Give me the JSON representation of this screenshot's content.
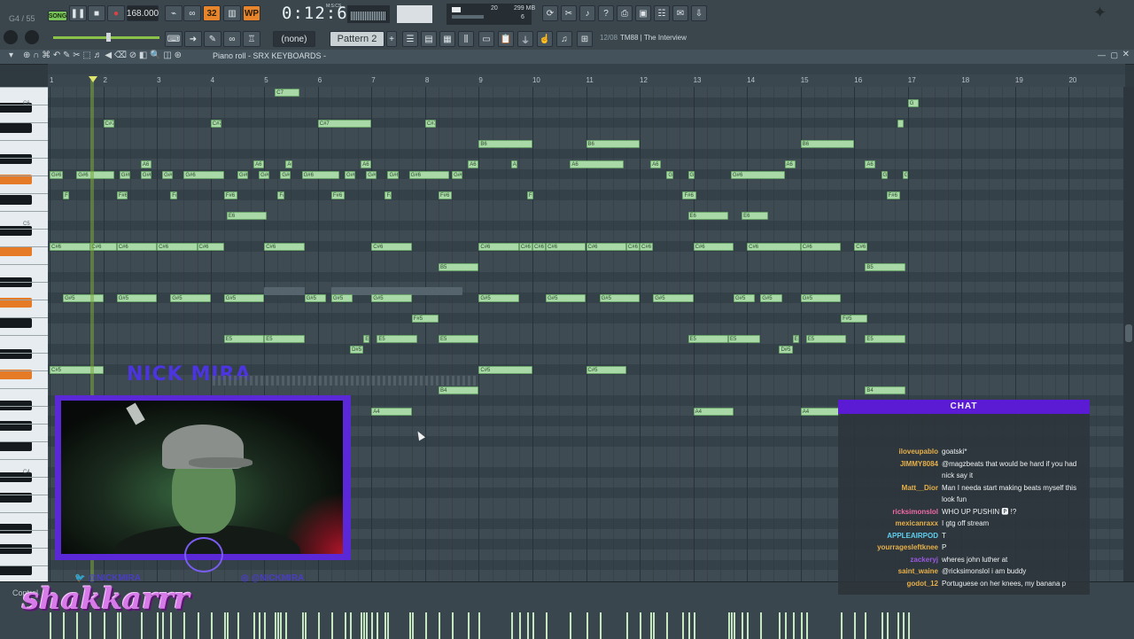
{
  "toolbar": {
    "song_label": "SONG",
    "tempo": "168.000",
    "time": "0:12:63",
    "time_unit": "M:S:CS",
    "memory": "299 MB",
    "cpu_left": "20",
    "cpu_right": "6",
    "snap_none": "(none)",
    "pattern": "Pattern 2",
    "hint_counter": "12/08",
    "hint_text": "TM88 | The Interview",
    "pos_readout": "G4 / 55",
    "btn_32": "32",
    "btn_wp": "WP"
  },
  "piano_roll": {
    "title": "Piano roll - SRX KEYBOARDS -",
    "bars": [
      "1",
      "2",
      "3",
      "4",
      "5",
      "6",
      "7",
      "8",
      "9",
      "10",
      "11",
      "12",
      "13",
      "14",
      "15",
      "16",
      "17",
      "18",
      "19",
      "20"
    ],
    "key_labels": [
      "C6",
      "C5",
      "C4"
    ],
    "notes": [
      {
        "label": "C7",
        "bar": 5.2,
        "len": 0.45,
        "row": 0
      },
      {
        "label": "G",
        "bar": 17.0,
        "len": 0.2,
        "row": 1
      },
      {
        "label": "C#7",
        "bar": 2.0,
        "len": 0.2,
        "row": 3
      },
      {
        "label": "C#7",
        "bar": 4.0,
        "len": 0.2,
        "row": 3
      },
      {
        "label": "C#7",
        "bar": 6.0,
        "len": 1.0,
        "row": 3
      },
      {
        "label": "C#7",
        "bar": 8.0,
        "len": 0.2,
        "row": 3
      },
      {
        "label": "",
        "bar": 16.8,
        "len": 0.12,
        "row": 3
      },
      {
        "label": "B6",
        "bar": 9.0,
        "len": 1.0,
        "row": 5
      },
      {
        "label": "B6",
        "bar": 11.0,
        "len": 1.0,
        "row": 5
      },
      {
        "label": "B6",
        "bar": 15.0,
        "len": 1.0,
        "row": 5
      },
      {
        "label": "A6",
        "bar": 2.7,
        "len": 0.2,
        "row": 7
      },
      {
        "label": "A6",
        "bar": 4.8,
        "len": 0.2,
        "row": 7
      },
      {
        "label": "A6",
        "bar": 5.4,
        "len": 0.12,
        "row": 7
      },
      {
        "label": "A6",
        "bar": 6.8,
        "len": 0.2,
        "row": 7
      },
      {
        "label": "A6",
        "bar": 8.8,
        "len": 0.2,
        "row": 7
      },
      {
        "label": "A6",
        "bar": 9.6,
        "len": 0.12,
        "row": 7
      },
      {
        "label": "A6",
        "bar": 10.7,
        "len": 1.0,
        "row": 7
      },
      {
        "label": "A6",
        "bar": 12.2,
        "len": 0.2,
        "row": 7
      },
      {
        "label": "A6",
        "bar": 14.7,
        "len": 0.2,
        "row": 7
      },
      {
        "label": "A6",
        "bar": 16.2,
        "len": 0.2,
        "row": 7
      },
      {
        "label": "G#6",
        "bar": 1.0,
        "len": 0.25,
        "row": 8
      },
      {
        "label": "G#6",
        "bar": 1.5,
        "len": 0.7,
        "row": 8
      },
      {
        "label": "G#6",
        "bar": 2.3,
        "len": 0.2,
        "row": 8
      },
      {
        "label": "G#6",
        "bar": 2.7,
        "len": 0.2,
        "row": 8
      },
      {
        "label": "G#6",
        "bar": 3.1,
        "len": 0.2,
        "row": 8
      },
      {
        "label": "G#6",
        "bar": 3.5,
        "len": 0.75,
        "row": 8
      },
      {
        "label": "G#6",
        "bar": 4.5,
        "len": 0.2,
        "row": 8
      },
      {
        "label": "G#6",
        "bar": 4.9,
        "len": 0.2,
        "row": 8
      },
      {
        "label": "G#6",
        "bar": 5.3,
        "len": 0.2,
        "row": 8
      },
      {
        "label": "G#6",
        "bar": 5.7,
        "len": 0.7,
        "row": 8
      },
      {
        "label": "G#6",
        "bar": 6.5,
        "len": 0.2,
        "row": 8
      },
      {
        "label": "G#6",
        "bar": 6.9,
        "len": 0.2,
        "row": 8
      },
      {
        "label": "G#6",
        "bar": 7.3,
        "len": 0.2,
        "row": 8
      },
      {
        "label": "G#6",
        "bar": 7.7,
        "len": 0.75,
        "row": 8
      },
      {
        "label": "G#6",
        "bar": 8.5,
        "len": 0.2,
        "row": 8
      },
      {
        "label": "G#6",
        "bar": 12.5,
        "len": 0.12,
        "row": 8
      },
      {
        "label": "G#6",
        "bar": 12.9,
        "len": 0.12,
        "row": 8
      },
      {
        "label": "G#6",
        "bar": 13.7,
        "len": 1.0,
        "row": 8
      },
      {
        "label": "G#6",
        "bar": 16.5,
        "len": 0.12,
        "row": 8
      },
      {
        "label": "G#6",
        "bar": 16.9,
        "len": 0.1,
        "row": 8
      },
      {
        "label": "F#6",
        "bar": 1.25,
        "len": 0.12,
        "row": 10
      },
      {
        "label": "F#6",
        "bar": 2.25,
        "len": 0.2,
        "row": 10
      },
      {
        "label": "F#6",
        "bar": 3.25,
        "len": 0.12,
        "row": 10
      },
      {
        "label": "F#6",
        "bar": 4.25,
        "len": 0.25,
        "row": 10
      },
      {
        "label": "F#6",
        "bar": 5.25,
        "len": 0.12,
        "row": 10
      },
      {
        "label": "F#6",
        "bar": 6.25,
        "len": 0.25,
        "row": 10
      },
      {
        "label": "F#6",
        "bar": 7.25,
        "len": 0.12,
        "row": 10
      },
      {
        "label": "F#6",
        "bar": 8.25,
        "len": 0.25,
        "row": 10
      },
      {
        "label": "F#6",
        "bar": 9.9,
        "len": 0.12,
        "row": 10
      },
      {
        "label": "F#6",
        "bar": 12.8,
        "len": 0.25,
        "row": 10
      },
      {
        "label": "F#6",
        "bar": 16.6,
        "len": 0.25,
        "row": 10
      },
      {
        "label": "E6",
        "bar": 4.3,
        "len": 0.75,
        "row": 12
      },
      {
        "label": "E6",
        "bar": 12.9,
        "len": 0.75,
        "row": 12
      },
      {
        "label": "E6",
        "bar": 13.9,
        "len": 0.5,
        "row": 12
      },
      {
        "label": "C#6",
        "bar": 1.0,
        "len": 0.8,
        "row": 15
      },
      {
        "label": "C#6",
        "bar": 1.75,
        "len": 0.5,
        "row": 15
      },
      {
        "label": "C#6",
        "bar": 2.25,
        "len": 0.75,
        "row": 15
      },
      {
        "label": "C#6",
        "bar": 3.0,
        "len": 0.75,
        "row": 15
      },
      {
        "label": "C#6",
        "bar": 3.75,
        "len": 0.5,
        "row": 15
      },
      {
        "label": "C#6",
        "bar": 5.0,
        "len": 0.75,
        "row": 15
      },
      {
        "label": "C#6",
        "bar": 7.0,
        "len": 0.75,
        "row": 15
      },
      {
        "label": "C#6",
        "bar": 9.0,
        "len": 0.75,
        "row": 15
      },
      {
        "label": "C#6",
        "bar": 9.75,
        "len": 0.25,
        "row": 15
      },
      {
        "label": "C#6",
        "bar": 10.0,
        "len": 0.25,
        "row": 15
      },
      {
        "label": "C#6",
        "bar": 10.25,
        "len": 0.75,
        "row": 15
      },
      {
        "label": "C#6",
        "bar": 11.0,
        "len": 0.75,
        "row": 15
      },
      {
        "label": "C#6",
        "bar": 11.75,
        "len": 0.25,
        "row": 15
      },
      {
        "label": "C#6",
        "bar": 12.0,
        "len": 0.25,
        "row": 15
      },
      {
        "label": "C#6",
        "bar": 13.0,
        "len": 0.75,
        "row": 15
      },
      {
        "label": "C#6",
        "bar": 14.0,
        "len": 1.0,
        "row": 15
      },
      {
        "label": "C#6",
        "bar": 15.0,
        "len": 0.75,
        "row": 15
      },
      {
        "label": "C#6",
        "bar": 16.0,
        "len": 0.25,
        "row": 15
      },
      {
        "label": "B5",
        "bar": 8.25,
        "len": 0.75,
        "row": 17
      },
      {
        "label": "B5",
        "bar": 16.2,
        "len": 0.75,
        "row": 17
      },
      {
        "label": "G#5",
        "bar": 1.25,
        "len": 0.75,
        "row": 20
      },
      {
        "label": "G#5",
        "bar": 2.25,
        "len": 0.75,
        "row": 20
      },
      {
        "label": "G#5",
        "bar": 3.25,
        "len": 0.75,
        "row": 20
      },
      {
        "label": "G#5",
        "bar": 4.25,
        "len": 0.75,
        "row": 20
      },
      {
        "label": "G#5",
        "bar": 5.75,
        "len": 0.4,
        "row": 20
      },
      {
        "label": "G#5",
        "bar": 6.25,
        "len": 0.4,
        "row": 20
      },
      {
        "label": "G#5",
        "bar": 7.0,
        "len": 0.75,
        "row": 20
      },
      {
        "label": "G#5",
        "bar": 9.0,
        "len": 0.75,
        "row": 20
      },
      {
        "label": "G#5",
        "bar": 10.25,
        "len": 0.75,
        "row": 20
      },
      {
        "label": "G#5",
        "bar": 11.25,
        "len": 0.75,
        "row": 20
      },
      {
        "label": "G#5",
        "bar": 12.25,
        "len": 0.75,
        "row": 20
      },
      {
        "label": "G#5",
        "bar": 13.75,
        "len": 0.4,
        "row": 20
      },
      {
        "label": "G#5",
        "bar": 14.25,
        "len": 0.4,
        "row": 20
      },
      {
        "label": "G#5",
        "bar": 15.0,
        "len": 0.75,
        "row": 20
      },
      {
        "label": "F#5",
        "bar": 7.75,
        "len": 0.5,
        "row": 22
      },
      {
        "label": "F#5",
        "bar": 15.75,
        "len": 0.5,
        "row": 22
      },
      {
        "label": "E5",
        "bar": 4.25,
        "len": 0.75,
        "row": 24
      },
      {
        "label": "E5",
        "bar": 5.0,
        "len": 0.75,
        "row": 24
      },
      {
        "label": "E5",
        "bar": 6.85,
        "len": 0.12,
        "row": 24
      },
      {
        "label": "E5",
        "bar": 7.1,
        "len": 0.75,
        "row": 24
      },
      {
        "label": "E5",
        "bar": 8.25,
        "len": 0.75,
        "row": 24
      },
      {
        "label": "E5",
        "bar": 12.9,
        "len": 0.75,
        "row": 24
      },
      {
        "label": "E5",
        "bar": 13.65,
        "len": 0.6,
        "row": 24
      },
      {
        "label": "E5",
        "bar": 14.85,
        "len": 0.12,
        "row": 24
      },
      {
        "label": "E5",
        "bar": 15.1,
        "len": 0.75,
        "row": 24
      },
      {
        "label": "E5",
        "bar": 16.2,
        "len": 0.75,
        "row": 24
      },
      {
        "label": "D#5",
        "bar": 6.6,
        "len": 0.25,
        "row": 25
      },
      {
        "label": "D#5",
        "bar": 14.6,
        "len": 0.25,
        "row": 25
      },
      {
        "label": "C#5",
        "bar": 1.0,
        "len": 1.0,
        "row": 27
      },
      {
        "label": "C#5",
        "bar": 9.0,
        "len": 1.0,
        "row": 27
      },
      {
        "label": "C#5",
        "bar": 11.0,
        "len": 0.75,
        "row": 27
      },
      {
        "label": "B4",
        "bar": 8.25,
        "len": 0.75,
        "row": 29
      },
      {
        "label": "B4",
        "bar": 16.2,
        "len": 0.75,
        "row": 29
      },
      {
        "label": "A4",
        "bar": 7.0,
        "len": 0.75,
        "row": 31
      },
      {
        "label": "A4",
        "bar": 13.0,
        "len": 0.75,
        "row": 31
      },
      {
        "label": "A4",
        "bar": 15.0,
        "len": 0.75,
        "row": 31
      }
    ]
  },
  "control_panel": {
    "label": "Control"
  },
  "stream": {
    "streamer_name": "NICK MIRA",
    "handle_left": "@NICKMIRA",
    "handle_right": "@NICKMIRA",
    "overlay_name": "shakkarrr"
  },
  "chat": {
    "header": "CHAT",
    "messages": [
      {
        "user": "iloveupablo",
        "color": "#e7b04a",
        "text": "goatski*"
      },
      {
        "user": "JIMMY8084",
        "color": "#e7b04a",
        "text": "@magzbeats that would be hard if you had nick say it"
      },
      {
        "user": "Matt__Dior",
        "color": "#e7b04a",
        "text": "Man I needa start making beats myself this look fun"
      },
      {
        "user": "ricksimonslol",
        "color": "#f06aa6",
        "text": "WHO UP PUSHIN 🅿 !?"
      },
      {
        "user": "mexicanraxx",
        "color": "#e7b04a",
        "text": "I gtg off stream"
      },
      {
        "user": "APPLEAIRPOD",
        "color": "#5fd0f0",
        "text": "T"
      },
      {
        "user": "yourragesleftknee",
        "color": "#e7b04a",
        "text": "P"
      },
      {
        "user": "zackeryj",
        "color": "#9a58e0",
        "text": "wheres john luther at"
      },
      {
        "user": "saint_waine",
        "color": "#e7b04a",
        "text": "@ricksimonslol i am buddy"
      },
      {
        "user": "godot_12",
        "color": "#e7b04a",
        "text": "Portuguese on her knees, my banana p"
      }
    ]
  }
}
